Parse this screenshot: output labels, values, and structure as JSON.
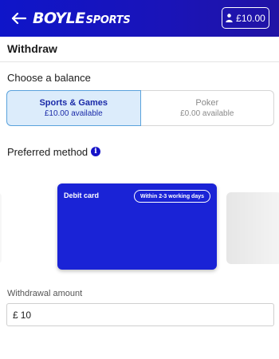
{
  "header": {
    "back_icon": "arrow-left-icon",
    "logo_main": "BOYLE",
    "logo_sub": "SPORTS",
    "account_icon": "user-icon",
    "balance": "£10.00",
    "background_color": "#1a14b8"
  },
  "page": {
    "title": "Withdraw"
  },
  "balance_section": {
    "label": "Choose a balance",
    "options": [
      {
        "name": "Sports & Games",
        "available": "£10.00 available",
        "selected": true
      },
      {
        "name": "Poker",
        "available": "£0.00 available",
        "selected": false
      }
    ]
  },
  "method_section": {
    "label": "Preferred method",
    "info_icon": "info-icon",
    "cards": [
      {
        "title": "Debit card",
        "badge": "Within 2-3 working days",
        "color": "#1a23d6"
      }
    ]
  },
  "amount_section": {
    "label": "Withdrawal amount",
    "currency": "£",
    "value": "10"
  }
}
